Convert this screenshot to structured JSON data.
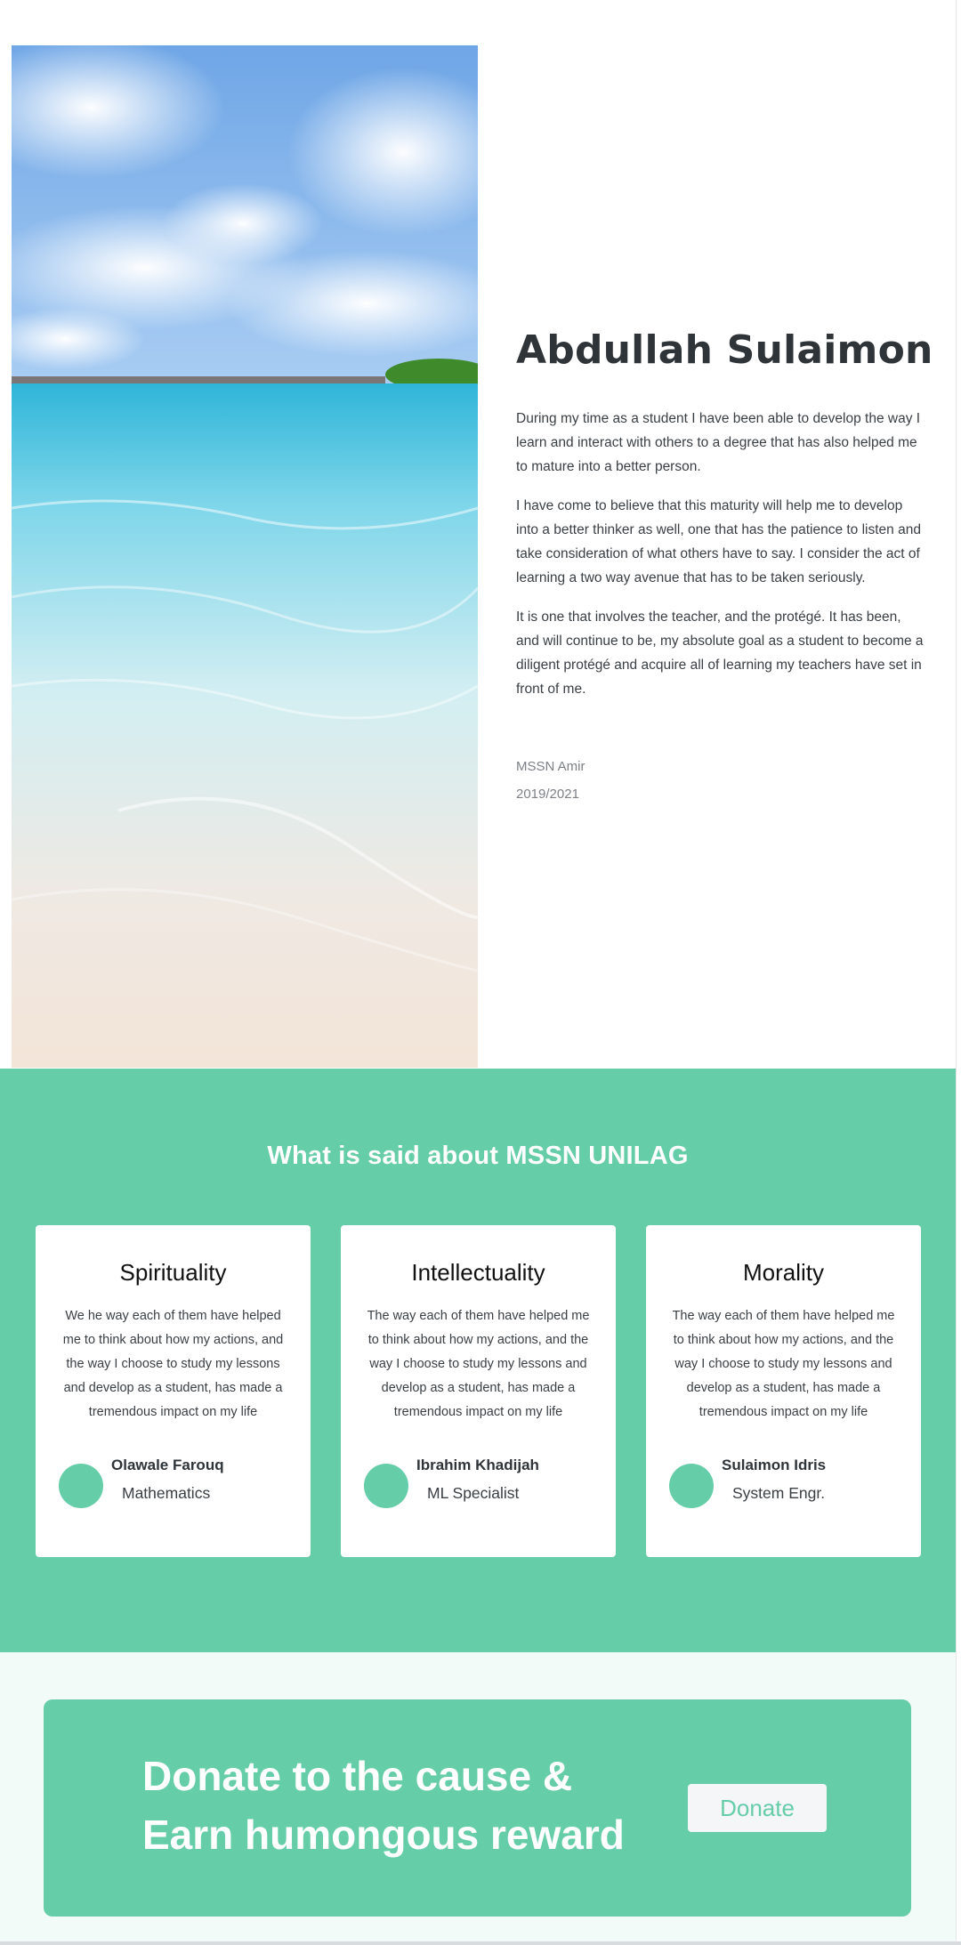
{
  "profile": {
    "image_alt": "beach-photo",
    "name": "Abdullah Sulaimon",
    "paragraphs": [
      "During my time as a student I have been able to develop the way I learn and interact with others to a degree that has also helped me to mature into a better person.",
      "I have come to believe that this maturity will help me to develop into a better thinker as well, one that has the patience to listen and take consideration of what others have to say. I consider the act of learning a two way avenue that has to be taken seriously.",
      "It is one that involves the teacher, and the protégé. It has been, and will continue to be, my absolute goal as a student to become a diligent protégé and acquire all of learning my teachers have set in front of me."
    ],
    "role": "MSSN Amir",
    "tenure": "2019/2021"
  },
  "testimonials": {
    "title": "What is said about MSSN UNILAG",
    "cards": [
      {
        "title": "Spirituality",
        "body": "We he way each of them have helped me to think about how my actions, and the way I choose to study my lessons and develop as a student, has made a tremendous impact on my life",
        "author": "Olawale Farouq",
        "role": "Mathematics"
      },
      {
        "title": "Intellectuality",
        "body": "The way each of them have helped me to think about how my actions, and the way I choose to study my lessons and develop as a student, has made a tremendous impact on my life",
        "author": "Ibrahim Khadijah",
        "role": "ML Specialist"
      },
      {
        "title": "Morality",
        "body": "The way each of them have helped me to think about how my actions, and the way I choose to study my lessons and develop as a student, has made a tremendous impact on my life",
        "author": "Sulaimon Idris",
        "role": "System Engr."
      }
    ]
  },
  "donate": {
    "line1": "Donate to the cause &",
    "line2": "Earn humongous reward",
    "button_label": "Donate"
  },
  "colors": {
    "accent": "#66cda9",
    "heading": "#2f3439",
    "text": "#3a3f44",
    "muted": "#7d8186",
    "donate_bg": "#f2fbf7"
  }
}
